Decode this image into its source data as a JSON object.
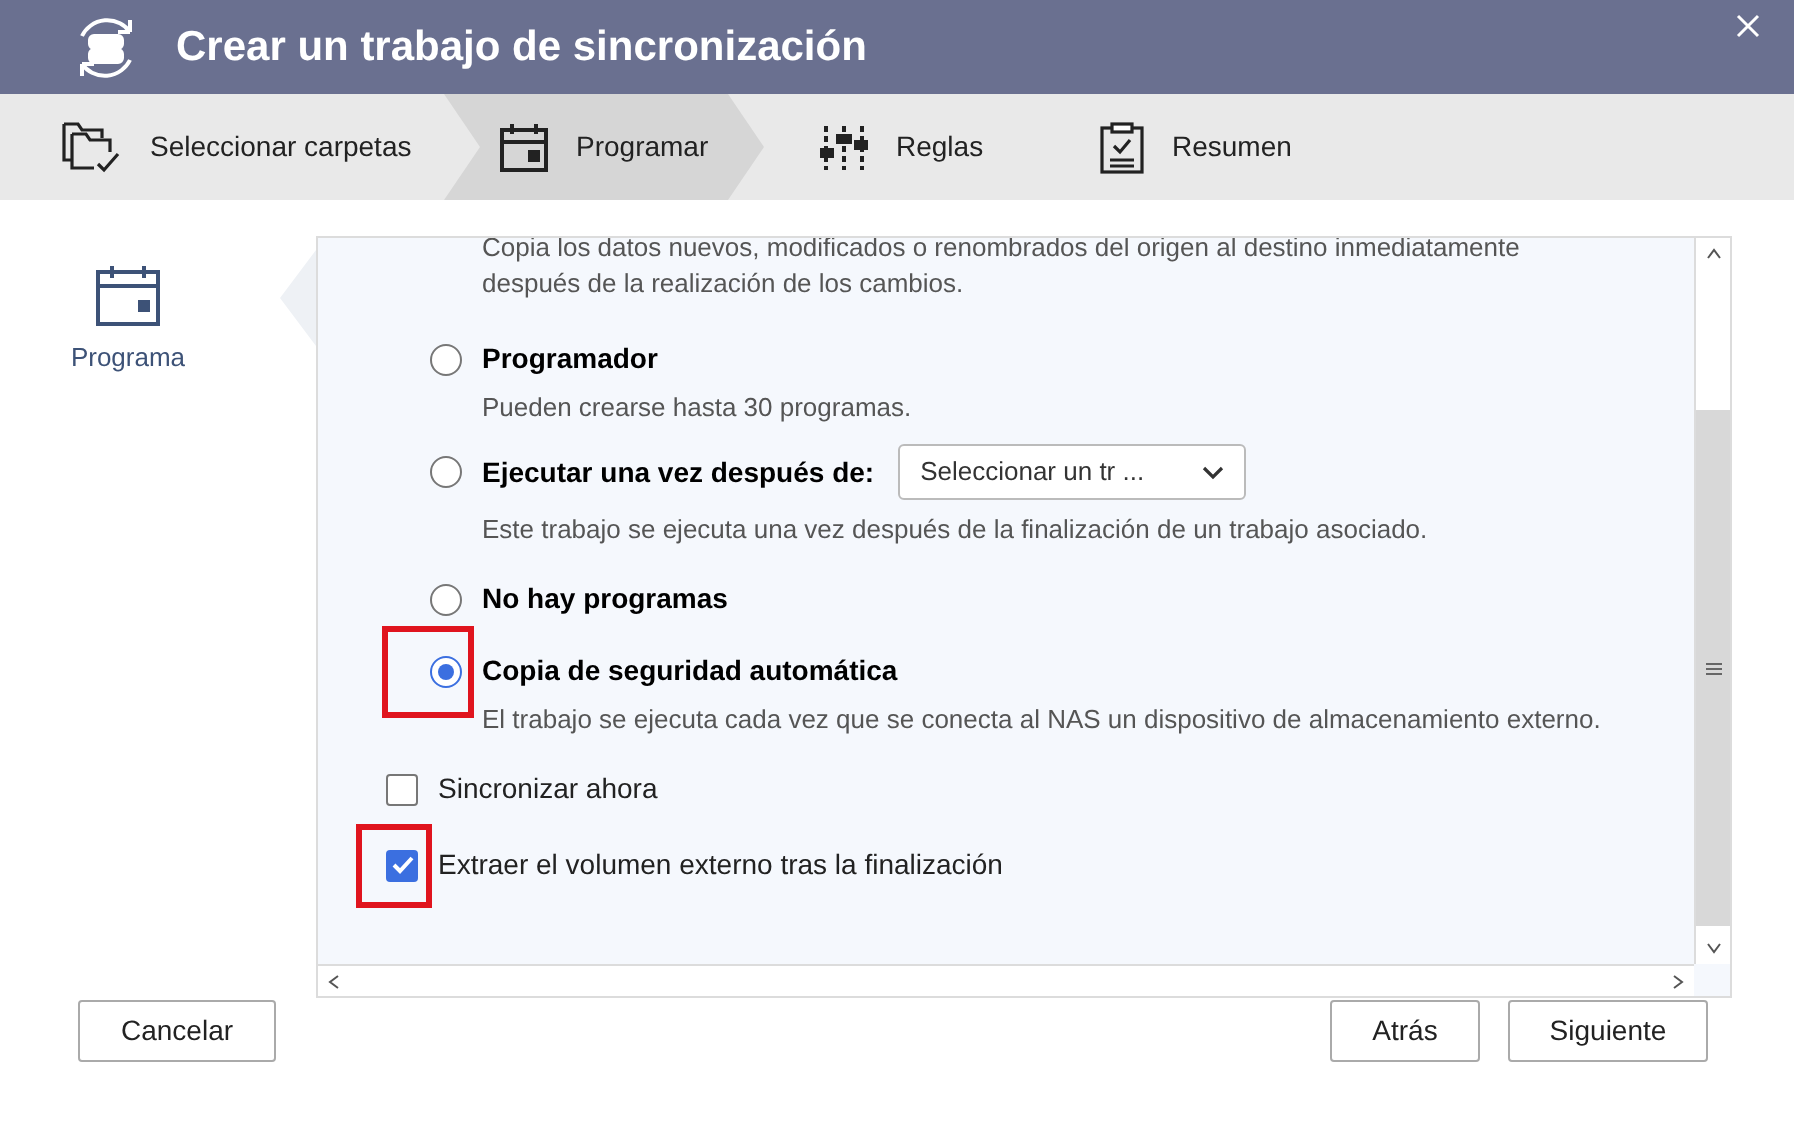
{
  "window": {
    "title": "Crear un trabajo de sincronización"
  },
  "steps": [
    {
      "label": "Seleccionar carpetas",
      "selected": false
    },
    {
      "label": "Programar",
      "selected": true
    },
    {
      "label": "Reglas",
      "selected": false
    },
    {
      "label": "Resumen",
      "selected": false
    }
  ],
  "sidebar": {
    "label": "Programa"
  },
  "intro": "Copia los datos nuevos, modificados o renombrados del origen al destino inmediatamente después de la realización de los cambios.",
  "options": [
    {
      "label": "Programador",
      "description": "Pueden crearse hasta 30 programas.",
      "selected": false,
      "highlighted": false
    },
    {
      "label": "Ejecutar una vez después de:",
      "dropdown": "Seleccionar un tr ...",
      "description": "Este trabajo se ejecuta una vez después de la finalización de un trabajo asociado.",
      "selected": false,
      "highlighted": false
    },
    {
      "label": "No hay programas",
      "selected": false,
      "highlighted": false
    },
    {
      "label": "Copia de seguridad automática",
      "description": "El trabajo se ejecuta cada vez que se conecta al NAS un dispositivo de almacenamiento externo.",
      "selected": true,
      "highlighted": true
    }
  ],
  "checkboxes": [
    {
      "label": "Sincronizar ahora",
      "checked": false,
      "highlighted": false
    },
    {
      "label": "Extraer el volumen externo tras la finalización",
      "checked": true,
      "highlighted": true
    }
  ],
  "buttons": {
    "cancel": "Cancelar",
    "back": "Atrás",
    "next": "Siguiente"
  }
}
